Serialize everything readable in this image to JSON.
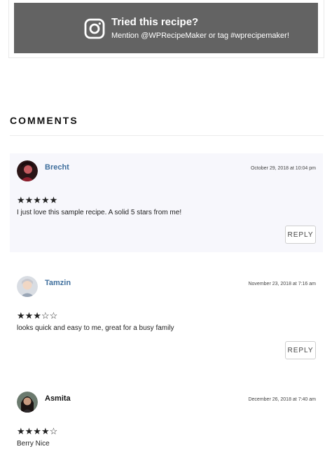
{
  "banner": {
    "title": "Tried this recipe?",
    "subtitle": "Mention @WPRecipeMaker or tag #wprecipemaker!",
    "icon": "instagram-icon",
    "background": "#636363"
  },
  "comments_section": {
    "heading": "COMMENTS",
    "comments": [
      {
        "author": "Brecht",
        "date": "October 29, 2018 at 10:04 pm",
        "rating": 5,
        "stars": "★★★★★",
        "text": "I just love this sample recipe. A solid 5 stars from me!",
        "reply_label": "REPLY"
      },
      {
        "author": "Tamzin",
        "date": "November 23, 2018 at 7:16 am",
        "rating": 3,
        "stars": "★★★☆☆",
        "text": "looks quick and easy to me, great for a busy family",
        "reply_label": "REPLY"
      },
      {
        "author": "Asmita",
        "date": "December 26, 2018 at 7:40 am",
        "rating": 4,
        "stars": "★★★★☆",
        "text": "Berry Nice"
      }
    ]
  },
  "colors": {
    "author_link": "#3f6f9d",
    "highlight_bg": "#f7f7fc"
  }
}
